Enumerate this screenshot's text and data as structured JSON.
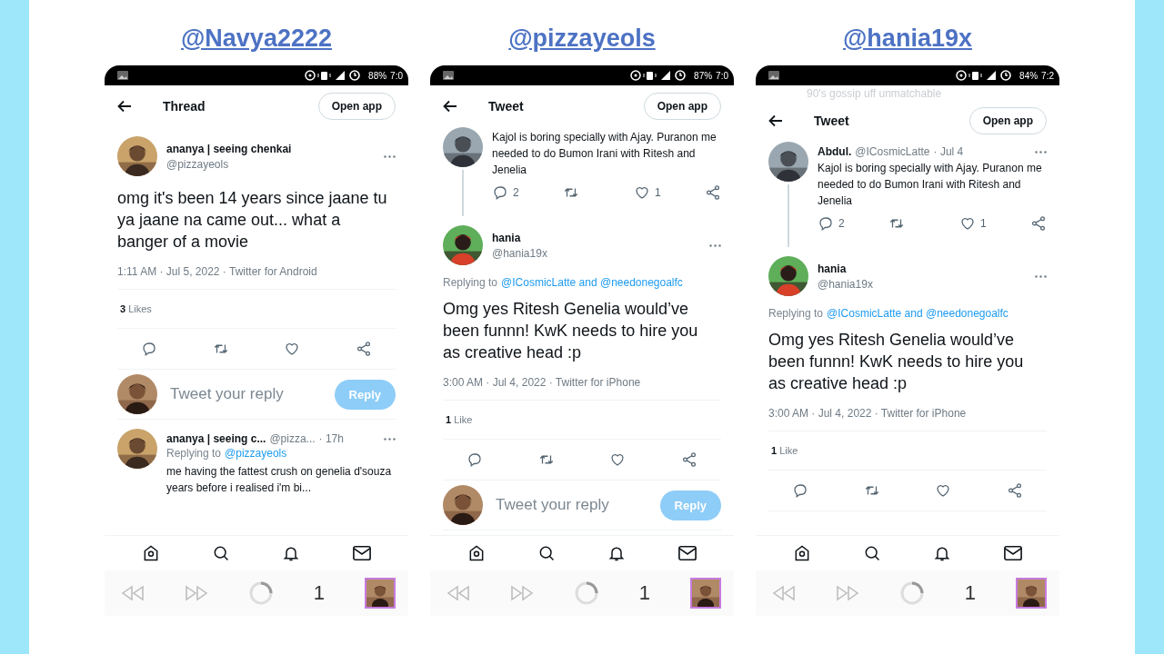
{
  "panels": [
    {
      "heading": "@Navya2222",
      "status": {
        "battery": "88%",
        "time": "7:0"
      },
      "header": {
        "title": "Thread",
        "button": "Open app"
      },
      "blocks": [
        {
          "kind": "main_tweet",
          "name": "ananya | seeing chenkai",
          "handle": "@pizzayeols",
          "text": "omg it's been 14 years since jaane tu ya jaane na came out... what a banger of a movie",
          "meta": "1:11 AM · Jul 5, 2022 · Twitter for Android",
          "likes_count": "3",
          "likes_label": "Likes"
        },
        {
          "kind": "actions"
        },
        {
          "kind": "composer",
          "placeholder": "Tweet your reply",
          "button": "Reply"
        },
        {
          "kind": "reply_tweet",
          "name": "ananya | seeing c...",
          "handle": "@pizza...",
          "time": "· 17h",
          "replying_prefix": "Replying to",
          "replying_to": "@pizzayeols",
          "text": "me having the fattest crush on genelia d'souza years before i realised i'm bi..."
        }
      ],
      "tab_count": "1"
    },
    {
      "heading": "@pizzayeols",
      "status": {
        "battery": "87%",
        "time": "7:0"
      },
      "header": {
        "title": "Tweet",
        "button": "Open app"
      },
      "blocks": [
        {
          "kind": "parent_tweet",
          "text": "Kajol is boring specially with Ajay. Puranon me needed to do Bumon Irani with Ritesh and Jenelia",
          "reply_count": "2",
          "like_count": "1"
        },
        {
          "kind": "main_tweet",
          "name": "hania",
          "handle": "@hania19x",
          "replying_prefix": "Replying to",
          "replying_to": "@ICosmicLatte and @needonegoalfc",
          "text": "Omg yes Ritesh Genelia would’ve been funnn! KwK needs to hire you as creative head :p",
          "meta": "3:00 AM · Jul 4, 2022 · Twitter for iPhone",
          "likes_count": "1",
          "likes_label": "Like"
        },
        {
          "kind": "actions"
        },
        {
          "kind": "composer",
          "placeholder": "Tweet your reply",
          "button": "Reply"
        }
      ],
      "tab_count": "1"
    },
    {
      "heading": "@hania19x",
      "status": {
        "battery": "84%",
        "time": "7:2"
      },
      "header": {
        "title": "Tweet",
        "button": "Open app"
      },
      "faded_line": "90's gossip uff unmatchable",
      "blocks": [
        {
          "kind": "parent_tweet",
          "name": "Abdul.",
          "handle": "@ICosmicLatte",
          "time": "· Jul 4",
          "text": "Kajol is boring specially with Ajay. Puranon me needed to do Bumon Irani with Ritesh and Jenelia",
          "reply_count": "2",
          "like_count": "1"
        },
        {
          "kind": "main_tweet",
          "name": "hania",
          "handle": "@hania19x",
          "replying_prefix": "Replying to",
          "replying_to": "@ICosmicLatte and @needonegoalfc",
          "text": "Omg yes Ritesh Genelia would’ve been funnn! KwK needs to hire you as creative head :p",
          "meta": "3:00 AM · Jul 4, 2022 · Twitter for iPhone",
          "likes_count": "1",
          "likes_label": "Like"
        },
        {
          "kind": "actions"
        }
      ],
      "tab_count": "1"
    }
  ]
}
